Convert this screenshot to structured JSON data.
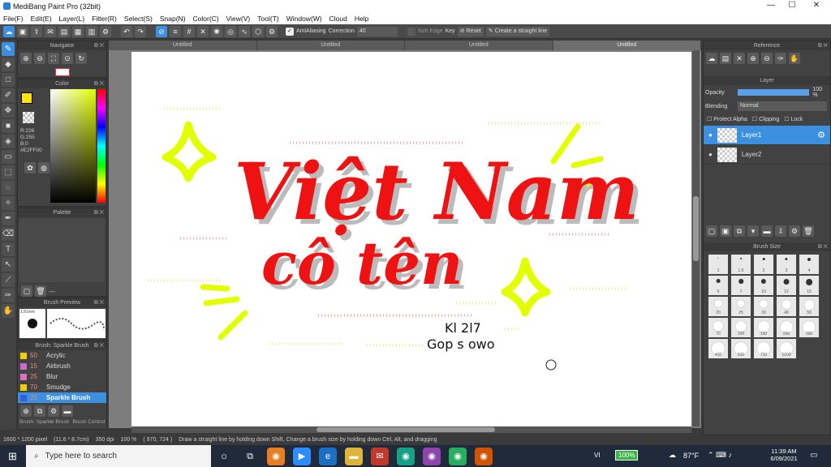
{
  "window": {
    "title": "MediBang Paint Pro (32bit)",
    "minimize": "—",
    "maximize": "☐",
    "close": "✕"
  },
  "menu": [
    "File(F)",
    "Edit(E)",
    "Layer(L)",
    "Filter(R)",
    "Select(S)",
    "Snap(N)",
    "Color(C)",
    "View(V)",
    "Tool(T)",
    "Window(W)",
    "Cloud",
    "Help"
  ],
  "toolbar": {
    "antialiasing": "AntiAliasing",
    "correction_label": "Correction",
    "correction_value": "40",
    "soft_edge": "Soft Edge",
    "key_label": "Key",
    "reset": "Reset",
    "straight_line": "Create a straight line"
  },
  "tabs": [
    "Untitled",
    "Untitled",
    "Untitled",
    "Untitled"
  ],
  "navigator": {
    "title": "Navigator"
  },
  "color": {
    "title": "Color",
    "r": "R:226",
    "g": "G:255",
    "b": "B:0",
    "hex": "#E2FF00",
    "primary": "#ffe400",
    "hue_bar": "#e2ff00"
  },
  "palette": {
    "title": "Palette",
    "value": "---"
  },
  "brush_preview": {
    "title": "Brush Preview",
    "size": "1.81mm"
  },
  "brush_list": {
    "title": "Brush: Sparkle Brush",
    "items": [
      {
        "size": "50",
        "name": "Acrylic",
        "color": "#f0d000"
      },
      {
        "size": "15",
        "name": "Airbrush",
        "color": "#c86ad0"
      },
      {
        "size": "25",
        "name": "Blur",
        "color": "#e070c0"
      },
      {
        "size": "70",
        "name": "Smudge",
        "color": "#f0d000"
      },
      {
        "size": "25",
        "name": "Sparkle Brush",
        "color": "#3060e0"
      }
    ],
    "tab_a": "Brush: Sparkle Brush",
    "tab_b": "Brush Control"
  },
  "artwork": {
    "line1": "Việt Nam",
    "line2": "cô tên",
    "sig1": "Kl 2l7",
    "sig2": "Gop s owo"
  },
  "reference": {
    "title": "Reference"
  },
  "layer_panel": {
    "title": "Layer",
    "opacity_label": "Opacity",
    "opacity_value": "100 %",
    "opacity_level": 1.0,
    "blending_label": "Blending",
    "blending_value": "Normal",
    "protect_alpha": "Protect Alpha",
    "clipping": "Clipping",
    "lock": "Lock",
    "layers": [
      "Layer1",
      "Layer2"
    ]
  },
  "brush_size": {
    "title": "Brush Size",
    "sizes": [
      "1",
      "1.5",
      "2",
      "3",
      "4",
      "5",
      "7",
      "10",
      "12",
      "15",
      "20",
      "25",
      "30",
      "40",
      "50",
      "70",
      "100",
      "150",
      "200",
      "300",
      "400",
      "500",
      "700",
      "1000"
    ]
  },
  "status": {
    "dims": "1600 * 1200 pixel",
    "physical": "(11.6 * 8.7cm)",
    "dpi": "350 dpi",
    "zoom": "100 %",
    "coords": "( 970, 724 )",
    "hint": "Draw a straight line by holding down Shift, Change a brush size by holding down Ctrl, Alt, and dragging"
  },
  "taskbar": {
    "search_placeholder": "Type here to search",
    "language": "VI",
    "battery": "100%",
    "weather": "87°F",
    "time": "11:39 AM",
    "date": "6/09/2021"
  }
}
